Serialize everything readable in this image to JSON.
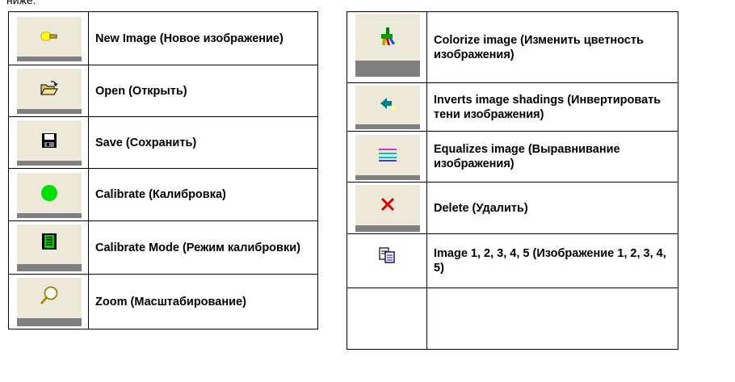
{
  "intro_text": "ниже:",
  "left_rows": [
    {
      "label": "New Image (Новое изображение)",
      "icon": "new-image-icon"
    },
    {
      "label": "Open (Открыть)",
      "icon": "open-folder-icon"
    },
    {
      "label": "Save (Сохранить)",
      "icon": "save-disk-icon"
    },
    {
      "label": "Calibrate (Калибровка)",
      "icon": "calibrate-dot-icon"
    },
    {
      "label": "Calibrate Mode (Режим калибровки)",
      "icon": "calibrate-mode-icon"
    },
    {
      "label": "Zoom (Масштабирование)",
      "icon": "zoom-magnifier-icon"
    }
  ],
  "right_rows": [
    {
      "label": "Colorize image (Изменить цветность изображения)",
      "icon": "colorize-icon"
    },
    {
      "label": "Inverts image shadings (Инвертировать тени изображения)",
      "icon": "invert-shading-icon"
    },
    {
      "label": "Equalizes image (Выравнивание изображения)",
      "icon": "equalize-icon"
    },
    {
      "label": "Delete (Удалить)",
      "icon": "delete-x-icon"
    },
    {
      "label": "Image 1, 2, 3, 4, 5 (Изображение 1, 2, 3, 4, 5)",
      "icon": "image-copy-icon"
    },
    {
      "label": "",
      "icon": ""
    }
  ],
  "colors": {
    "button_face": "#ece9d8",
    "button_shadow": "#808080",
    "green": "#00e000",
    "yellow": "#ffff00",
    "red": "#e00000",
    "cyan": "#00c0c0"
  }
}
